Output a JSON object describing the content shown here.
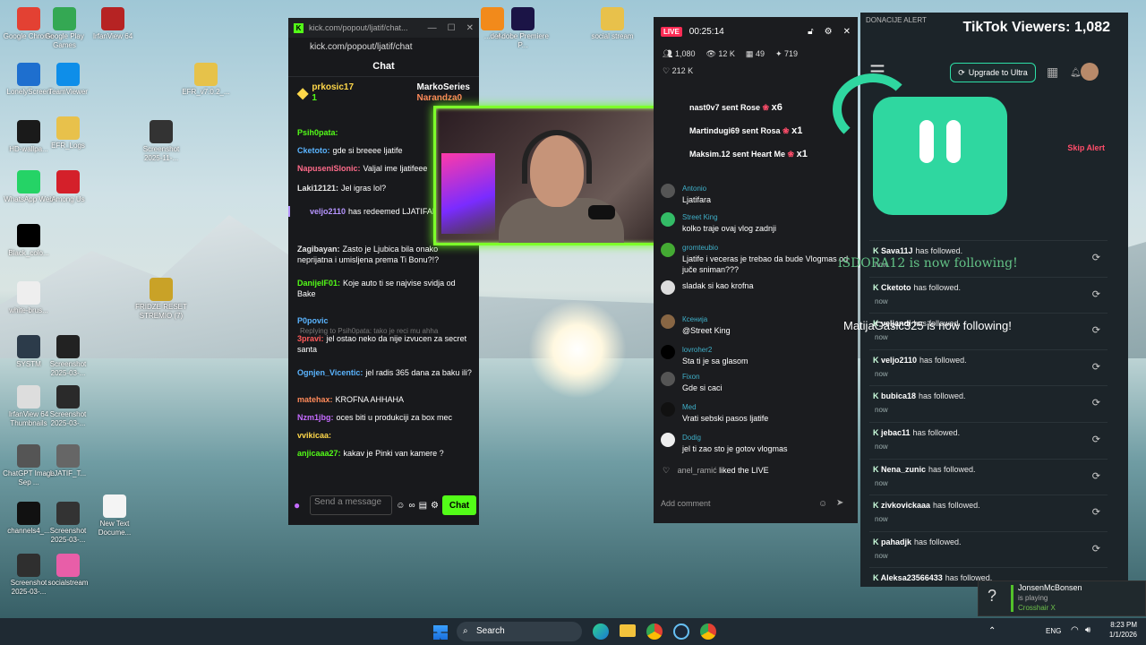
{
  "desktop_icons": [
    {
      "label": "Google Chrome",
      "color": "#e34133"
    },
    {
      "label": "Google Play Games",
      "color": "#34a853"
    },
    {
      "label": "IrfanView 64",
      "color": "#b62323"
    },
    {
      "label": "LonelyScreen",
      "color": "#1e6fcf"
    },
    {
      "label": "TeamViewer",
      "color": "#0e8ee9"
    },
    {
      "label": "EFR_v7.0.2_...",
      "color": "#e6c24a"
    },
    {
      "label": "HD-wallpa...",
      "color": "#1a1a1a"
    },
    {
      "label": "EFR_Logs",
      "color": "#e8c14b"
    },
    {
      "label": "Screenshot 2025-11-...",
      "color": "#333"
    },
    {
      "label": "WhatsApp Web",
      "color": "#25d366"
    },
    {
      "label": "Among Us",
      "color": "#d4202a"
    },
    {
      "label": "Black_colo...",
      "color": "#000"
    },
    {
      "label": "white-brus...",
      "color": "#eee"
    },
    {
      "label": "FRIDZE RESET STREMIO (7)",
      "color": "#c9a227"
    },
    {
      "label": "SYSTM",
      "color": "#2c3b4a"
    },
    {
      "label": "Screenshot 2025-03-...",
      "color": "#222"
    },
    {
      "label": "IrfanView 64 Thumbnails",
      "color": "#ddd"
    },
    {
      "label": "Screenshot 2025-03-...",
      "color": "#2a2a2a"
    },
    {
      "label": "ChatGPT Image Sep ...",
      "color": "#555"
    },
    {
      "label": "LJATIF_T...",
      "color": "#666"
    },
    {
      "label": "channels4_...",
      "color": "#111"
    },
    {
      "label": "Screenshot 2025-03-...",
      "color": "#333"
    },
    {
      "label": "New Text Docume...",
      "color": "#f4f4f4"
    },
    {
      "label": "Screenshot 2025-03-...",
      "color": "#2f2f2f"
    },
    {
      "label": "socialstream",
      "color": "#e85ea8"
    },
    {
      "label": "Adobe Premiere P...",
      "color": "#1b1446"
    },
    {
      "label": "social stream",
      "color": "#e8c14b"
    },
    {
      "label": "...der",
      "color": "#f28a1b"
    }
  ],
  "kick": {
    "tab_title": "kick.com/popout/ljatif/chat...",
    "url": "kick.com/popout/ljatif/chat",
    "heading": "Chat",
    "pin_user1": "prkosic17",
    "pin_count1": "1",
    "pin_user2": "MarkoSeries",
    "pin_user3": "Narandza0",
    "messages": [
      {
        "user": "Psih0pata:",
        "text": "",
        "color": "#53fc18"
      },
      {
        "user": "Cketoto:",
        "text": "gde si breeee ljatife",
        "color": "#5ab4ff"
      },
      {
        "user": "NapuseniSlonic:",
        "text": "Valjal ime ljatifeee",
        "color": "#ff6b8a"
      },
      {
        "user": "Laki12121:",
        "text": "Jel igras lol?",
        "color": "#e8e8e8"
      },
      {
        "user": "veljo2110",
        "text": "has redeemed LJATIFANER",
        "color": "#b695ff"
      },
      {
        "user": "Zagibayan:",
        "text": "Zasto je Ljubica bila onako neprijatna i umisljena prema Ti Bonu?!?",
        "color": "#e8e8e8"
      },
      {
        "user": "DanijelF01:",
        "text": "Koje auto ti se najvise svidja od Bake",
        "color": "#53fc18"
      },
      {
        "user": "P0povic",
        "text": "Replying to Psih0pata: tako je reci mu ahha",
        "color": "#5ab4ff"
      },
      {
        "user": "3pravi:",
        "text": "jel ostao neko da nije izvucen za secret santa",
        "color": "#ff5a5a"
      },
      {
        "user": "Ognjen_Vicentic:",
        "text": "jel radis 365 dana za baku ili?",
        "color": "#5ab4ff"
      },
      {
        "user": "matehax:",
        "text": "KROFNA AHHAHA",
        "color": "#ff8a5a"
      },
      {
        "user": "Nzm1jbg:",
        "text": "oces biti u produkciji za box mec",
        "color": "#c56bff"
      },
      {
        "user": "vvikicaa:",
        "text": "",
        "color": "#ffd84a"
      },
      {
        "user": "anjicaaa27:",
        "text": "kakav je Pinki van kamere ?",
        "color": "#53fc18"
      }
    ],
    "input_placeholder": "Send a message",
    "chat_button": "Chat"
  },
  "tiktok": {
    "live_badge": "LIVE",
    "timer": "00:25:14",
    "stats": [
      "1,080",
      "12 K",
      "49",
      "719"
    ],
    "likes": "212 K",
    "gifts": [
      {
        "text": "nast0v7 sent Rose",
        "count": "x6"
      },
      {
        "text": "Martindugi69 sent Rosa",
        "count": "x1"
      },
      {
        "text": "Maksim.12 sent Heart Me",
        "count": "x1"
      }
    ],
    "comments": [
      {
        "name": "Antonio",
        "text": "Ljatifara"
      },
      {
        "name": "Street King",
        "text": "kolko traje ovaj vlog zadnji"
      },
      {
        "name": "gromteubio",
        "text": "Ljatife i veceras je trebao da bude Vlogmas od juče sniman???"
      },
      {
        "name": "",
        "text": "sladak si kao krofna"
      },
      {
        "name": "Ксенија",
        "text": "@Street King"
      },
      {
        "name": "lovroher2",
        "text": "Sta ti je sa glasom"
      },
      {
        "name": "Fixon",
        "text": "Gde si caci"
      },
      {
        "name": "Med",
        "text": "Vrati sebski pasos ljatife"
      },
      {
        "name": "Dodig",
        "text": "jel ti zao sto je gotov vlogmas"
      }
    ],
    "liked_user": "anel_ramić",
    "liked_text": "liked the LIVE",
    "add_comment": "Add comment"
  },
  "donation": {
    "title": "DONACIJE ALERT",
    "viewers": "TikTok Viewers: 1,082",
    "upgrade": "Upgrade to Ultra",
    "skip": "Skip Alert",
    "followers": [
      {
        "user": "Sava11J",
        "action": "has followed.",
        "when": "now"
      },
      {
        "user": "Cketoto",
        "action": "has followed.",
        "when": "now"
      },
      {
        "user": "veljandi",
        "action": "has followed.",
        "when": "now"
      },
      {
        "user": "veljo2110",
        "action": "has followed.",
        "when": "now"
      },
      {
        "user": "bubica18",
        "action": "has followed.",
        "when": "now"
      },
      {
        "user": "jebac11",
        "action": "has followed.",
        "when": "now"
      },
      {
        "user": "Nena_zunic",
        "action": "has followed.",
        "when": "now"
      },
      {
        "user": "zivkovickaaa",
        "action": "has followed.",
        "when": "now"
      },
      {
        "user": "pahadjk",
        "action": "has followed.",
        "when": "now"
      },
      {
        "user": "Aleksa23566433",
        "action": "has followed.",
        "when": ""
      }
    ],
    "overlay1": "iSDORA12 is now following!",
    "overlay2": "MatijaGasic325 is now following!"
  },
  "notification": {
    "name": "JonsenMcBonsen",
    "status": "is playing",
    "game": "Crosshair X"
  },
  "taskbar": {
    "search": "Search",
    "lang": "ENG",
    "time": "8:23 PM",
    "date": "1/1/2026"
  },
  "colors": {
    "kick_green": "#53fc18",
    "tiktok_red": "#fe2c55",
    "accent_teal": "#2fd7a0"
  }
}
